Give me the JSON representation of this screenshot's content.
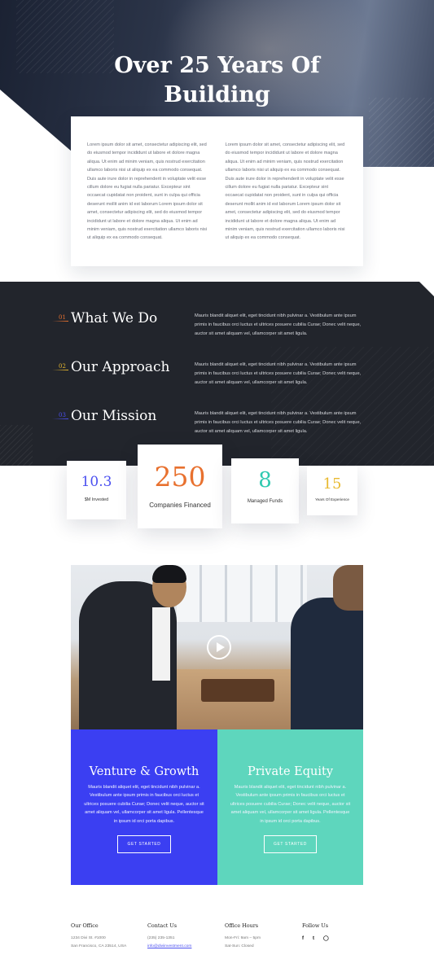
{
  "hero": {
    "title_line1": "Over 25 Years Of",
    "title_line2": "Building"
  },
  "intro": {
    "col1": "Lorem ipsum dolor sit amet, consectetur adipiscing elit, sed do eiusmod tempor incididunt ut labore et dolore magna aliqua. Ut enim ad minim veniam, quis nostrud exercitation ullamco laboris nisi ut aliquip ex ea commodo consequat. Duis aute irure dolor in reprehenderit in voluptate velit esse cillum dolore eu fugiat nulla pariatur. Excepteur sint occaecat cupidatat non proident, sunt in culpa qui officia deserunt mollit anim id est laborum Lorem ipsum dolor sit amet, consectetur adipiscing elit, sed do eiusmod tempor incididunt ut labore et dolore magna aliqua. Ut enim ad minim veniam, quis nostrud exercitation ullamco laboris nisi ut aliquip ex ea commodo consequat.",
    "col2": "Lorem ipsum dolor sit amet, consectetur adipiscing elit, sed do eiusmod tempor incididunt ut labore et dolore magna aliqua. Ut enim ad minim veniam, quis nostrud exercitation ullamco laboris nisi ut aliquip ex ea commodo consequat. Duis aute irure dolor in reprehenderit in voluptate velit esse cillum dolore eu fugiat nulla pariatur. Excepteur sint occaecat cupidatat non proident, sunt in culpa qui officia deserunt mollit anim id est laborum Lorem ipsum dolor sit amet, consectetur adipiscing elit, sed do eiusmod tempor incididunt ut labore et dolore magna aliqua. Ut enim ad minim veniam, quis nostrud exercitation ullamco laboris nisi ut aliquip ex ea commodo consequat."
  },
  "features": [
    {
      "num": "01",
      "num_color": "#e8712f",
      "title": "What We Do",
      "text": "Mauris blandit aliquet elit, eget tincidunt nibh pulvinar a. Vestibulum ante ipsum primis in faucibus orci luctus et ultrices posuere cubilia Curae; Donec velit neque, auctor sit amet aliquam vel, ullamcorper sit amet ligula."
    },
    {
      "num": "02",
      "num_color": "#e8b92f",
      "title": "Our Approach",
      "text": "Mauris blandit aliquet elit, eget tincidunt nibh pulvinar a. Vestibulum ante ipsum primis in faucibus orci luctus et ultrices posuere cubilia Curae; Donec velit neque, auctor sit amet aliquam vel, ullamcorper sit amet ligula."
    },
    {
      "num": "03",
      "num_color": "#4b50f0",
      "title": "Our Mission",
      "text": "Mauris blandit aliquet elit, eget tincidunt nibh pulvinar a. Vestibulum ante ipsum primis in faucibus orci luctus et ultrices posuere cubilia Curae; Donec velit neque, auctor sit amet aliquam vel, ullamcorper sit amet ligula."
    }
  ],
  "stats": [
    {
      "value": "10.3",
      "label": "$M Invested",
      "color": "#4b50f0"
    },
    {
      "value": "250",
      "label": "Companies Financed",
      "color": "#e8712f"
    },
    {
      "value": "8",
      "label": "Managed Funds",
      "color": "#2fc9b0"
    },
    {
      "value": "15",
      "label": "Years Of Experience",
      "color": "#e8b92f"
    }
  ],
  "services": [
    {
      "title": "Venture & Growth",
      "text": "Mauris blandit aliquet elit, eget tincidunt nibh pulvinar a. Vestibulum ante ipsum primis in faucibus orci luctus et ultrices posuere cubilia Curae; Donec velit neque, auctor sit amet aliquam vel, ullamcorper sit amet ligula. Pellentesque in ipsum id orci porta dapibus.",
      "button": "GET STARTED",
      "bg": "#3b3ff2"
    },
    {
      "title": "Private Equity",
      "text": "Mauris blandit aliquet elit, eget tincidunt nibh pulvinar a. Vestibulum ante ipsum primis in faucibus orci luctus et ultrices posuere cubilia Curae; Donec velit neque, auctor sit amet aliquam vel, ullamcorper sit amet ligula. Pellentesque in ipsum id orci porta dapibus.",
      "button": "GET STARTED",
      "bg": "#5ed6bd"
    }
  ],
  "footer": {
    "office": {
      "heading": "Our Office",
      "line1": "1234 Divi St. #1000",
      "line2": "San Francisco, CA 23514, USA"
    },
    "contact": {
      "heading": "Contact Us",
      "phone": "(235) 235-1351",
      "email": "info@diviinvestment.com"
    },
    "hours": {
      "heading": "Office Hours",
      "line1": "Mon-Fri: 9am – 5pm",
      "line2": "Sat-Sun: Closed"
    },
    "follow": {
      "heading": "Follow Us",
      "icons": [
        "facebook-icon",
        "twitter-icon",
        "instagram-icon"
      ]
    }
  }
}
